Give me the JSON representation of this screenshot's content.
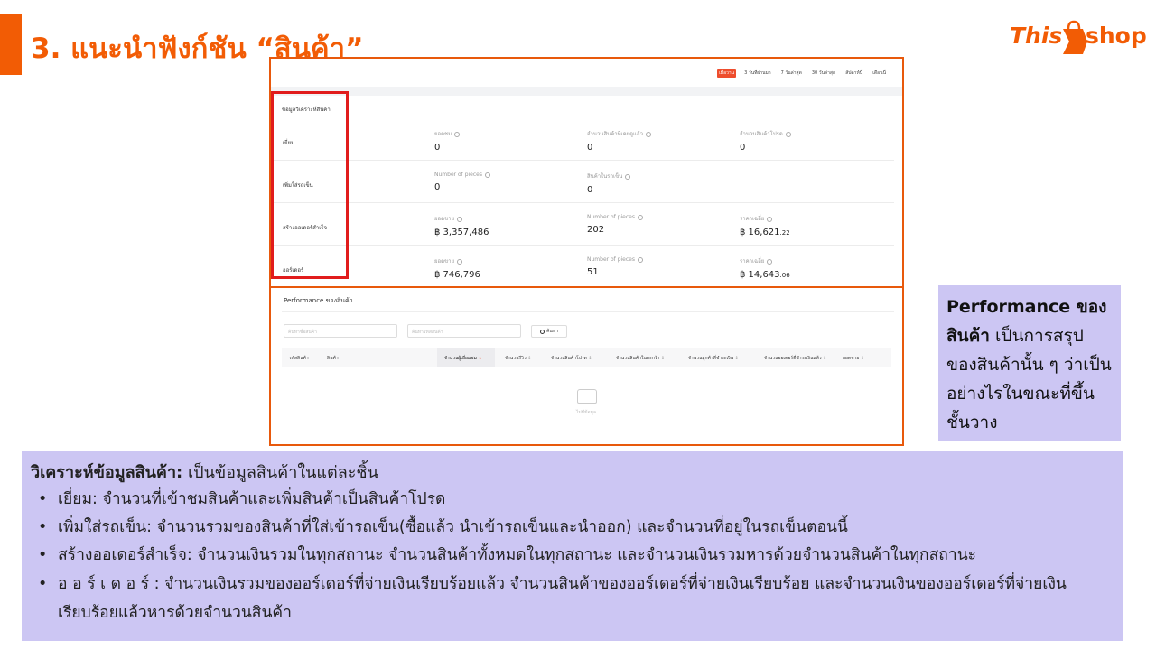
{
  "slide": {
    "title": "3. แนะนำฟังก์ชัน “สินค้า”",
    "logo_left": "This",
    "logo_right": "shop",
    "brand_color": "#f25c05"
  },
  "period_tabs": [
    "เมื่อวาน",
    "3 วันที่ผ่านมา",
    "7 วันล่าสุด",
    "30 วันล่าสุด",
    "สัปดาห์นี้",
    "เดือนนี้"
  ],
  "analysis": {
    "section_title": "ข้อมูลวิเคราะห์สินค้า",
    "rows": [
      {
        "label": "เยี่ยม",
        "metrics": [
          {
            "label": "ยอดชม",
            "value": "0"
          },
          {
            "label": "จำนวนสินค้าที่เคยดูแล้ว",
            "value": "0"
          },
          {
            "label": "จำนวนสินค้าโปรด",
            "value": "0"
          }
        ]
      },
      {
        "label": "เพิ่มใส่รถเข็น",
        "metrics": [
          {
            "label": "Number of pieces",
            "value": "0"
          },
          {
            "label": "สินค้าในรถเข็น",
            "value": "0"
          }
        ]
      },
      {
        "label": "สร้างออเดอร์สำเร็จ",
        "metrics": [
          {
            "label": "ยอดขาย",
            "value": "฿ 3,357,486"
          },
          {
            "label": "Number of pieces",
            "value": "202"
          },
          {
            "label": "ราคาเฉลี่ย",
            "value": "฿ 16,621",
            "decimals": ".22"
          }
        ]
      },
      {
        "label": "ออร์เดอร์",
        "metrics": [
          {
            "label": "ยอดขาย",
            "value": "฿ 746,796"
          },
          {
            "label": "Number of pieces",
            "value": "51"
          },
          {
            "label": "ราคาเฉลี่ย",
            "value": "฿ 14,643",
            "decimals": ".06"
          }
        ]
      }
    ]
  },
  "performance": {
    "title": "Performance ของสินค้า",
    "search_name_placeholder": "ค้นหาชื่อสินค้า",
    "search_code_placeholder": "ค้นหารหัสสินค้า",
    "search_button": "ค้นหา",
    "columns": [
      "รหัสสินค้า",
      "สินค้า",
      "จำนวนผู้เยี่ยมชม",
      "จำนวนรีวิว",
      "จำนวนสินค้าโปรด",
      "จำนวนสินค้าในตะกร้า",
      "จำนวนลูกค้าที่ชำระเงิน",
      "จำนวนออเดอร์ที่ชำระเงินแล้ว",
      "ยอดขาย"
    ],
    "empty_text": "ไม่มีข้อมูล"
  },
  "side_note": {
    "bold": "Performance ของสินค้า",
    "text": " เป็นการสรุปของสินค้านั้น ๆ ว่าเป็นอย่างไรในขณะที่ขึ้นชั้นวาง"
  },
  "explanation": {
    "head_bold": "วิเคราะห์ข้อมูลสินค้า:",
    "head_text": "  เป็นข้อมูลสินค้าในแต่ละชิ้น",
    "items": [
      "เยี่ยม:  จำนวนที่เข้าชมสินค้าและเพิ่มสินค้าเป็นสินค้าโปรด",
      "เพิ่มใส่รถเข็น:  จำนวนรวมของสินค้าที่ใส่เข้ารถเข็น(ซื้อแล้ว นำเข้ารถเข็นและนำออก) และจำนวนที่อยู่ในรถเข็นตอนนี้",
      "สร้างออเดอร์สำเร็จ:  จำนวนเงินรวมในทุกสถานะ จำนวนสินค้าทั้งหมดในทุกสถานะ และจำนวนเงินรวมหารด้วยจำนวนสินค้าในทุกสถานะ",
      "อ อ ร์ เ ด อ ร์  :   จำนวนเงินรวมของออร์เดอร์ที่จ่ายเงินเรียบร้อยแล้ว จำนวนสินค้าของออร์เดอร์ที่จ่ายเงินเรียบร้อย และจำนวนเงินของออร์เดอร์ที่จ่ายเงินเรียบร้อยแล้วหารด้วยจำนวนสินค้า"
    ]
  }
}
